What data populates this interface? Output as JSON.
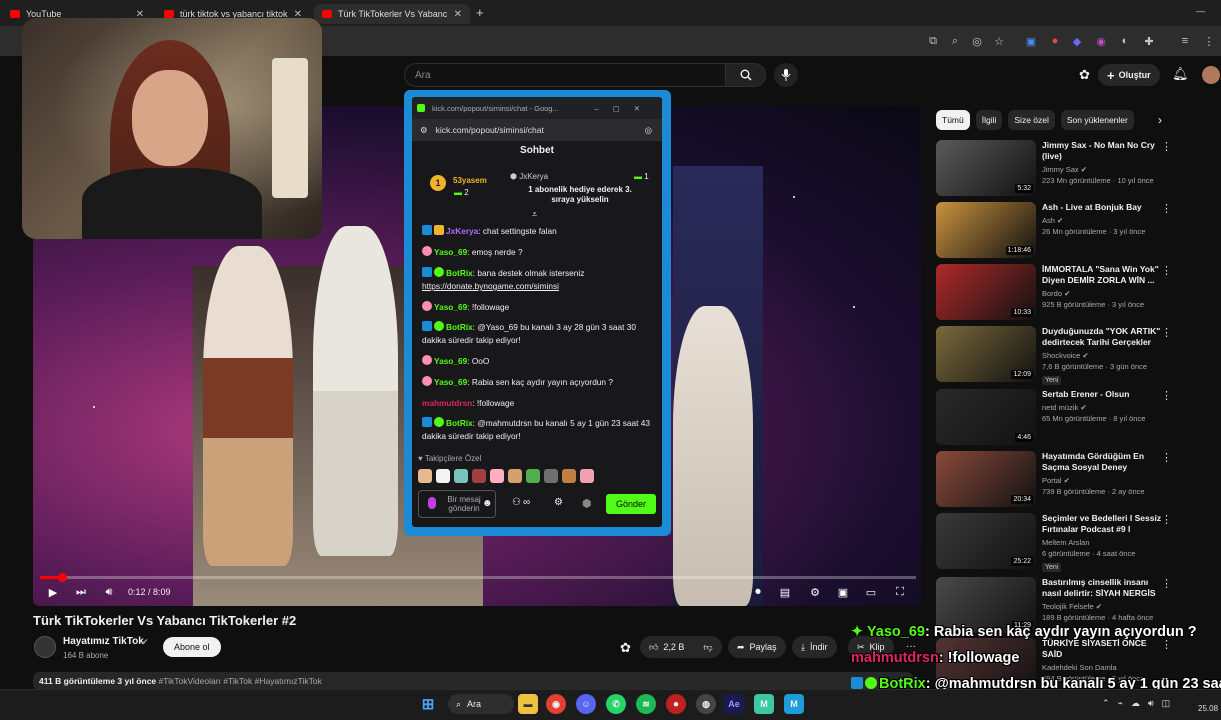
{
  "browser": {
    "tabs": [
      {
        "label": "YouTube",
        "close": "✕"
      },
      {
        "label": "türk tiktok vs yabancı tiktok - Yo",
        "close": "✕"
      },
      {
        "label": "Türk TikTokerler Vs Yabancı Tikt",
        "close": "✕"
      }
    ],
    "new_tab": "+",
    "minimize": "—"
  },
  "youtube_header": {
    "search_placeholder": "Ara",
    "create_label": "Oluştur"
  },
  "player": {
    "time": "0:12 / 8:09",
    "progress_fraction": 0.015
  },
  "video": {
    "title": "Türk TikTokerler Vs Yabancı TikTokerler #2",
    "channel": "Hayatımız TikTok",
    "subscribers": "164 B abone",
    "subscribe_label": "Abone ol",
    "likes": "2,2 B",
    "share_label": "Paylaş",
    "download_label": "İndir",
    "clip_label": "Klip",
    "more": "···",
    "description_stats": "411 B görüntüleme  3 yıl önce",
    "description_tags": "#TikTokVideoları #TikTok #HayatımızTikTok"
  },
  "chips": [
    "Tümü",
    "İlgili",
    "Size özel",
    "Son yüklenenler"
  ],
  "recommendations": [
    {
      "title": "Jimmy Sax - No Man No Cry (live)",
      "channel": "Jimmy Sax ✔",
      "views": "223 Mn görüntüleme · 10 yıl önce",
      "duration": "5:32",
      "badge": "",
      "thumb": "#5a5a5a"
    },
    {
      "title": "Ash - Live at Bonjuk Bay",
      "channel": "Ash ✔",
      "views": "26 Mn görüntüleme · 3 yıl önce",
      "duration": "1:18:46",
      "badge": "",
      "thumb": "#c9923e"
    },
    {
      "title": "İMMORTALA \"Sana Win Yok\" Diyen DEMİR ZORLA WİN ...",
      "channel": "Bordo ✔",
      "views": "925 B görüntüleme · 3 yıl önce",
      "duration": "10:33",
      "badge": "",
      "thumb": "#b02a2a"
    },
    {
      "title": "Duyduğunuzda \"YOK ARTIK\" dedirtecek Tarihi Gerçekler",
      "channel": "Shockvoice ✔",
      "views": "7,6 B görüntüleme · 3 gün önce",
      "duration": "12:09",
      "badge": "Yeni",
      "thumb": "#7a6a3a"
    },
    {
      "title": "Sertab Erener - Olsun",
      "channel": "netd müzik ✔",
      "views": "65 Mn görüntüleme · 8 yıl önce",
      "duration": "4:46",
      "badge": "",
      "thumb": "#2a2a2a"
    },
    {
      "title": "Hayatımda Gördüğüm En Saçma Sosyal Deney",
      "channel": "Portal ✔",
      "views": "739 B görüntüleme · 2 ay önce",
      "duration": "20:34",
      "badge": "",
      "thumb": "#8a4a3a"
    },
    {
      "title": "Seçimler ve Bedelleri I Sessiz Fırtınalar Podcast #9 I Meltem...",
      "channel": "Meltem Arslan",
      "views": "6 görüntüleme · 4 saat önce",
      "duration": "25:22",
      "badge": "Yeni",
      "thumb": "#3a3a3a"
    },
    {
      "title": "Bastırılmış cinsellik insanı nasıl delirtir: SİYAH NERGİS",
      "channel": "Teolojik Felsefe ✔",
      "views": "189 B görüntüleme · 4 hafta önce",
      "duration": "11:29",
      "badge": "",
      "thumb": "#4a4a4a"
    },
    {
      "title": "TÜRKİYE SİYASETİ ÖNCE SAİD",
      "channel": "Kadehdeki Son Damla",
      "views": "494 B görüntüleme · 2 yıl önce",
      "duration": "",
      "badge": "",
      "thumb": "#553333"
    }
  ],
  "chat": {
    "window_title": "kick.com/popout/siminsi/chat - Goog...",
    "url": "kick.com/popout/siminsi/chat",
    "header": "Sohbet",
    "pinned": {
      "rank": "1",
      "leader": "53yasem",
      "leader_count": "2",
      "gifter": "JxKerya",
      "gifter_count": "1",
      "text": "1 abonelik hediye ederek 3. sıraya yükselin"
    },
    "messages": [
      {
        "user": "JxKerya",
        "text": ": chat settingste falan",
        "color": "#b06bff"
      },
      {
        "user": "Yaso_69",
        "text": ": emoş nerde ?",
        "color": "#53fc18"
      },
      {
        "user": "BotRix",
        "text": ": bana destek olmak isterseniz",
        "link": "https://donate.bynogame.com/siminsi",
        "color": "#53fc18"
      },
      {
        "user": "Yaso_69",
        "text": ": !followage",
        "color": "#53fc18"
      },
      {
        "user": "BotRix",
        "text": ": @Yaso_69 bu kanalı 3 ay 28 gün 3 saat 30 dakika süredir takip ediyor!",
        "color": "#53fc18"
      },
      {
        "user": "Yaso_69",
        "text": ": OoO",
        "color": "#53fc18"
      },
      {
        "user": "Yaso_69",
        "text": ": Rabia sen kaç aydır yayın açıyordun ?",
        "color": "#53fc18"
      },
      {
        "user": "mahmutdrsn",
        "text": ": !followage",
        "color": "#e0245e"
      },
      {
        "user": "BotRix",
        "text": ": @mahmutdrsn bu kanalı 5 ay 1 gün 23 saat 43 dakika süredir takip ediyor!",
        "color": "#53fc18"
      }
    ],
    "followers_label": "Takipçilere Özel",
    "input_placeholder": "Bir mesaj gönderin",
    "infinity": "∞",
    "send_label": "Gönder"
  },
  "overlay_chat": [
    {
      "user": "Yaso_69",
      "text": ": Rabia sen kaç aydır yayın açıyordun ?",
      "color": "#53fc18"
    },
    {
      "user": "mahmutdrsn",
      "text": ": !followage",
      "color": "#e0245e"
    },
    {
      "user": "BotRix",
      "text": ": @mahmutdrsn bu kanalı 5 ay 1 gün 23 saat",
      "color": "#53fc18"
    },
    {
      "user": "",
      "text": "43 dakika süredir takip ediyor!",
      "color": "#fff"
    }
  ],
  "taskbar": {
    "search_label": "Ara",
    "date": "25.08"
  }
}
